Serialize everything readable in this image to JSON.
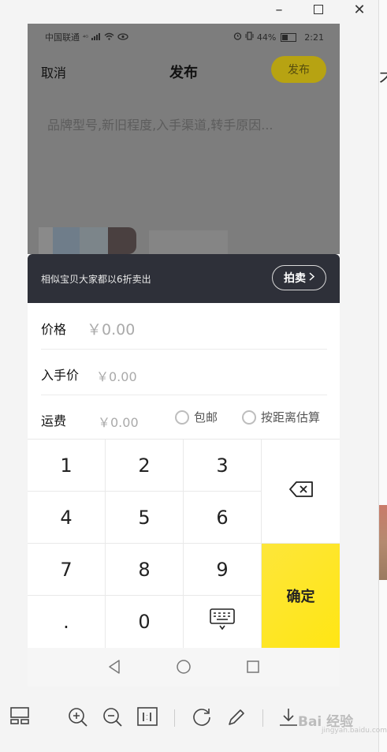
{
  "window": {
    "minimize_icon": "minimize-icon",
    "maximize_icon": "maximize-icon",
    "close_icon": "close-icon"
  },
  "statusbar": {
    "carrier": "中国联通",
    "network": "⁴ᴳ",
    "battery": "44%",
    "time": "2:21"
  },
  "header": {
    "cancel": "取消",
    "title": "发布",
    "publish": "发布"
  },
  "description": {
    "placeholder": "品牌型号,新旧程度,入手渠道,转手原因..."
  },
  "banner": {
    "text": "相似宝贝大家都以6折卖出",
    "button": "拍卖"
  },
  "form": {
    "price": {
      "label": "价格",
      "value": "￥0.00"
    },
    "cost": {
      "label": "入手价",
      "value": "￥0.00"
    },
    "shipping": {
      "label": "运费",
      "value": "￥0.00",
      "option_free": "包邮",
      "option_distance": "按距离估算"
    }
  },
  "keypad": {
    "keys": {
      "k1": "1",
      "k2": "2",
      "k3": "3",
      "k4": "4",
      "k5": "5",
      "k6": "6",
      "k7": "7",
      "k8": "8",
      "k9": "9",
      "kdot": ".",
      "k0": "0"
    },
    "confirm": "确定"
  },
  "watermark": {
    "text": "Bai 经验",
    "sub": "jingyan.baidu.com"
  },
  "colors": {
    "accent": "#ffe614",
    "banner_bg": "#2e3039",
    "overlay": "#7d7d7d"
  }
}
